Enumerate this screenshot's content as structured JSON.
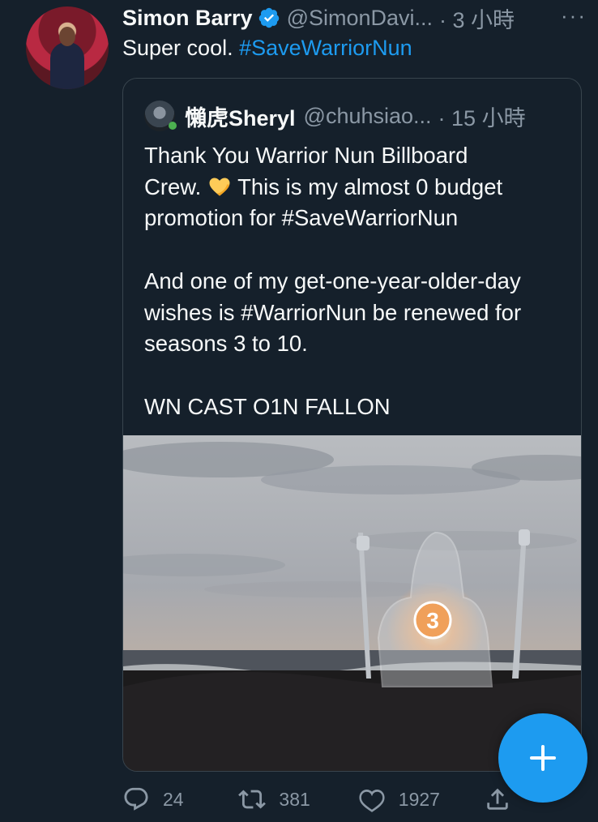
{
  "tweet": {
    "author_name": "Simon Barry",
    "author_handle": "@SimonDavi...",
    "time": "· 3 小時",
    "more": "···",
    "text_prefix": "Super cool. ",
    "hashtag": "#SaveWarriorNun"
  },
  "quoted": {
    "author_name": "懶虎Sheryl",
    "author_handle": "@chuhsiao...",
    "time": "· 15 小時",
    "body_part1": "Thank You Warrior Nun Billboard\nCrew. ",
    "body_part2": " This is my almost 0 budget\npromotion for #SaveWarriorNun\n\nAnd one of my get-one-year-older-day\nwishes is #WarriorNun be renewed for\nseasons 3 to 10.\n\nWN CAST O1N FALLON",
    "emoji": "yellow-heart",
    "sculpture_number": "3"
  },
  "actions": {
    "replies": "24",
    "retweets": "381",
    "likes": "1927"
  },
  "colors": {
    "background": "#15202b",
    "accent": "#1d9bf0",
    "muted": "#8b98a5",
    "border": "#38444d"
  }
}
